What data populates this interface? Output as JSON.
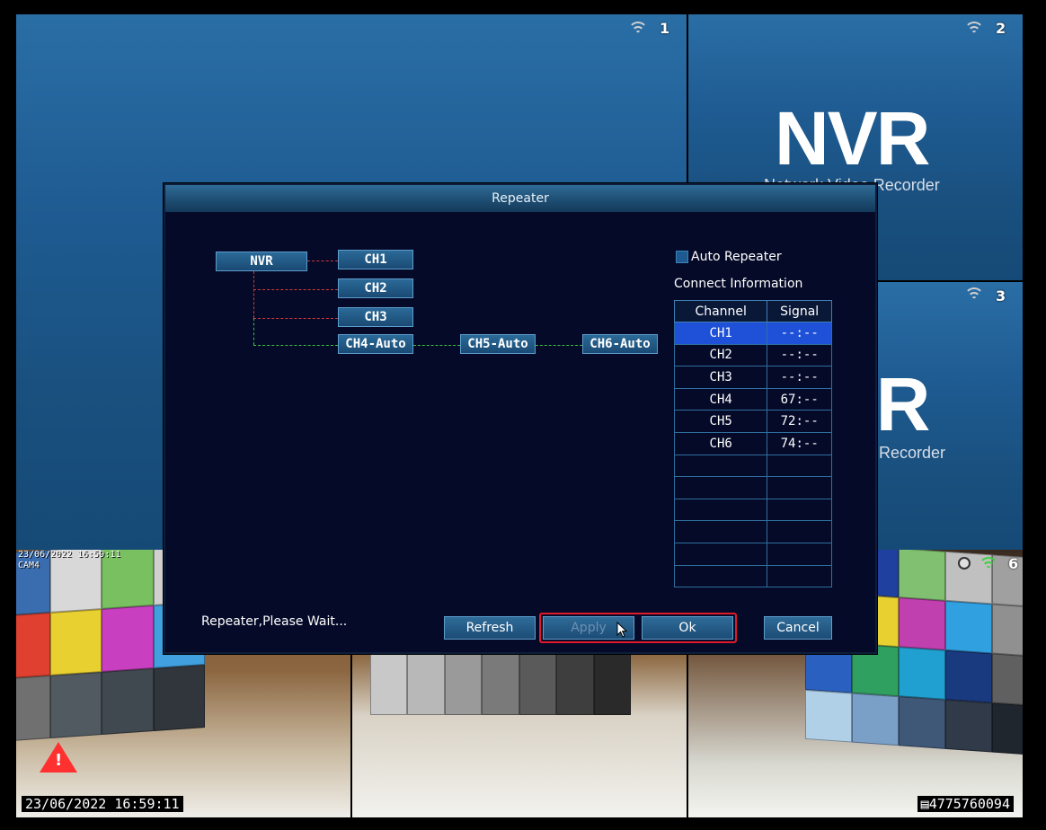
{
  "tiles": {
    "t1": {
      "number": "1"
    },
    "t2": {
      "number": "2",
      "logo": "NVR",
      "logo_sub": "Network Video Recorder"
    },
    "t3": {
      "number": "3",
      "logo": "NVR",
      "logo_sub": "Recorder"
    },
    "t4": {
      "osd_date": "23/06/2022 16:59:11",
      "osd_cam": "CAM4"
    },
    "t6": {
      "number": "6"
    }
  },
  "osd": {
    "date_time": "23/06/2022 16:59:11",
    "serial": "4775760094"
  },
  "dialog": {
    "title": "Repeater",
    "topology": {
      "nvr": "NVR",
      "ch1": "CH1",
      "ch2": "CH2",
      "ch3": "CH3",
      "ch4": "CH4-Auto",
      "ch5": "CH5-Auto",
      "ch6": "CH6-Auto"
    },
    "auto_repeater_label": "Auto Repeater",
    "connect_info_label": "Connect Information",
    "table": {
      "headers": [
        "Channel",
        "Signal"
      ],
      "rows": [
        [
          "CH1",
          "--:--"
        ],
        [
          "CH2",
          "--:--"
        ],
        [
          "CH3",
          "--:--"
        ],
        [
          "CH4",
          "67:--"
        ],
        [
          "CH5",
          "72:--"
        ],
        [
          "CH6",
          "74:--"
        ]
      ],
      "selected_row": 0
    },
    "status": "Repeater,Please Wait...",
    "buttons": {
      "refresh": "Refresh",
      "apply": "Apply",
      "ok": "Ok",
      "cancel": "Cancel"
    }
  },
  "colors": {
    "dialog_bg": "#050a28",
    "accent": "#1e50d8",
    "highlight_box": "#e01a2a",
    "link_wired": "#d23a3a",
    "link_wireless": "#3fbf3f"
  }
}
